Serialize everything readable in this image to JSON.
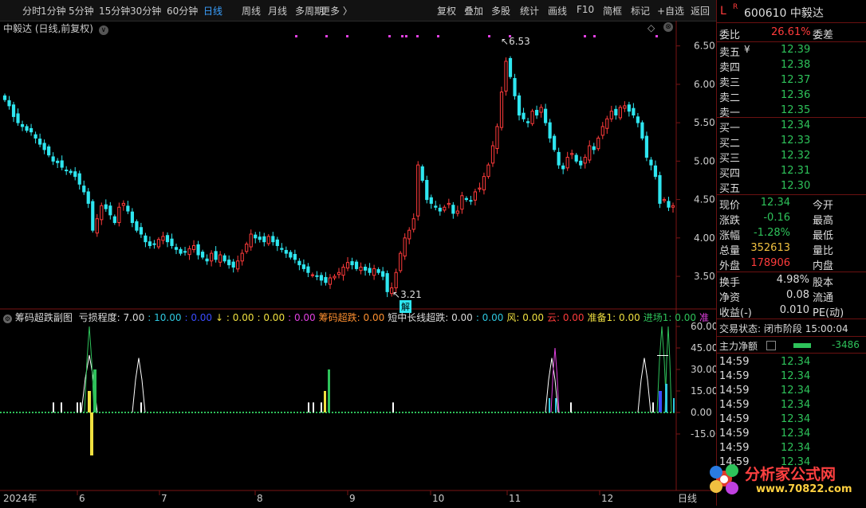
{
  "toolbar": {
    "left_tabs": [
      "分时",
      "1分钟",
      "5分钟",
      "15分钟",
      "30分钟",
      "60分钟",
      "日线",
      "周线",
      "月线",
      "多周期",
      "更多 〉"
    ],
    "active": "日线",
    "right_buttons": [
      "复权",
      "叠加",
      "多股",
      "统计",
      "画线",
      "F10",
      "简框",
      "标记",
      "+自选",
      "返回"
    ]
  },
  "main_title": "中毅达 (日线,前复权)",
  "y_ticks": [
    "6.50",
    "6.00",
    "5.50",
    "5.00",
    "4.50",
    "4.00",
    "3.50"
  ],
  "high_label": "6.53",
  "low_label": "3.21",
  "low_badge": "解",
  "indicator": {
    "name": "筹码超跌副图",
    "items": [
      {
        "label": "亏损程度: ",
        "value": "7.00",
        "color": "#ddd"
      },
      {
        "label": ": ",
        "value": "10.00",
        "color": "#2ec8e0"
      },
      {
        "label": ": ",
        "value": "0.00",
        "color": "#3a4cff"
      },
      {
        "label": "↓ : ",
        "value": "0.00",
        "color": "#f0e040"
      },
      {
        "label": ": ",
        "value": "0.00",
        "color": "#f0e040"
      },
      {
        "label": ": ",
        "value": "0.00",
        "color": "#e040e0"
      },
      {
        "label": "筹码超跌: ",
        "value": "0.00",
        "color": "#ff9030"
      },
      {
        "label": "短中长线超跌: ",
        "value": "0.00",
        "color": "#ddd"
      },
      {
        "label": ": ",
        "value": "0.00",
        "color": "#2ec8e0"
      },
      {
        "label": "风: ",
        "value": "0.00",
        "color": "#f0e040"
      },
      {
        "label": "云: ",
        "value": "0.00",
        "color": "#ff3b3b"
      },
      {
        "label": "准备1: ",
        "value": "0.00",
        "color": "#f0e040"
      },
      {
        "label": "进场1: ",
        "value": "0.00",
        "color": "#2ec25a"
      },
      {
        "label": "准",
        "value": "",
        "color": "#e040e0"
      }
    ],
    "y_ticks": [
      "60.00",
      "45.00",
      "30.00",
      "15.00",
      "0.00",
      "-15.00"
    ]
  },
  "x_labels": [
    "2024年",
    "6",
    "7",
    "8",
    "9",
    "10",
    "11",
    "12",
    "日线"
  ],
  "stock": {
    "code": "600610",
    "name": "中毅达",
    "l_badge": "L",
    "r_badge": "R"
  },
  "weibi": {
    "label": "委比",
    "value": "26.61%",
    "label2": "委差"
  },
  "asks": [
    {
      "label": "卖五",
      "mark": "¥",
      "price": "12.39"
    },
    {
      "label": "卖四",
      "mark": "",
      "price": "12.38"
    },
    {
      "label": "卖三",
      "mark": "",
      "price": "12.37"
    },
    {
      "label": "卖二",
      "mark": "",
      "price": "12.36"
    },
    {
      "label": "卖一",
      "mark": "",
      "price": "12.35"
    }
  ],
  "bids": [
    {
      "label": "买一",
      "price": "12.34"
    },
    {
      "label": "买二",
      "price": "12.33"
    },
    {
      "label": "买三",
      "price": "12.32"
    },
    {
      "label": "买四",
      "price": "12.31"
    },
    {
      "label": "买五",
      "price": "12.30"
    }
  ],
  "quote": [
    {
      "label": "现价",
      "value": "12.34",
      "color": "green",
      "label2": "今开"
    },
    {
      "label": "涨跌",
      "value": "-0.16",
      "color": "green",
      "label2": "最高"
    },
    {
      "label": "涨幅",
      "value": "-1.28%",
      "color": "green",
      "label2": "最低"
    },
    {
      "label": "总量",
      "value": "352613",
      "color": "yellow",
      "label2": "量比"
    },
    {
      "label": "外盘",
      "value": "178906",
      "color": "red",
      "label2": "内盘"
    }
  ],
  "stats": [
    {
      "label": "换手",
      "value": "4.98%",
      "label2": "股本"
    },
    {
      "label": "净资",
      "value": "0.08",
      "label2": "流通"
    },
    {
      "label": "收益(-)",
      "value": "0.010",
      "label2": "PE(动)"
    }
  ],
  "trade_status": {
    "label": "交易状态:",
    "value": "闭市阶段",
    "time": "15:00:04"
  },
  "net_flow": {
    "label": "主力净额",
    "value": "-3486"
  },
  "ticks": [
    {
      "time": "14:59",
      "price": "12.34"
    },
    {
      "time": "14:59",
      "price": "12.34"
    },
    {
      "time": "14:59",
      "price": "12.34"
    },
    {
      "time": "14:59",
      "price": "12.34"
    },
    {
      "time": "14:59",
      "price": "12.34"
    },
    {
      "time": "14:59",
      "price": "12.34"
    },
    {
      "time": "14:59",
      "price": "12.34"
    },
    {
      "time": "14:59",
      "price": "12.34"
    }
  ],
  "logo": {
    "text": "分析家公式网",
    "url": "www.70822.com"
  },
  "colors": {
    "up": "#ff3b3b",
    "down": "#2ee6f0",
    "accent": "#3aa0ff",
    "magenta": "#e040e0"
  },
  "chart_data": {
    "type": "candlestick",
    "ylim": [
      3.2,
      6.6
    ],
    "close": [
      5.8,
      5.72,
      5.58,
      5.5,
      5.45,
      5.4,
      5.38,
      5.3,
      5.22,
      5.15,
      5.08,
      5.0,
      4.98,
      4.92,
      4.88,
      4.85,
      4.8,
      4.7,
      4.6,
      4.45,
      4.1,
      4.25,
      4.42,
      4.38,
      4.3,
      4.2,
      4.4,
      4.45,
      4.35,
      4.2,
      4.1,
      4.05,
      3.95,
      3.9,
      3.92,
      3.98,
      4.02,
      3.95,
      3.9,
      3.85,
      3.8,
      3.82,
      3.86,
      3.9,
      3.78,
      3.75,
      3.7,
      3.8,
      3.72,
      3.78,
      3.7,
      3.65,
      3.62,
      3.7,
      3.8,
      3.92,
      4.05,
      4.0,
      3.98,
      3.95,
      4.02,
      3.95,
      3.9,
      3.85,
      3.8,
      3.75,
      3.72,
      3.65,
      3.6,
      3.55,
      3.52,
      3.5,
      3.45,
      3.42,
      3.48,
      3.5,
      3.55,
      3.62,
      3.68,
      3.65,
      3.6,
      3.62,
      3.58,
      3.55,
      3.6,
      3.55,
      3.5,
      3.3,
      3.35,
      3.55,
      3.8,
      4.0,
      4.1,
      4.25,
      4.95,
      4.75,
      4.5,
      4.45,
      4.4,
      4.35,
      4.4,
      4.45,
      4.32,
      4.35,
      4.55,
      4.5,
      4.48,
      4.6,
      4.65,
      4.8,
      4.95,
      5.2,
      5.45,
      5.9,
      6.3,
      6.1,
      5.85,
      5.6,
      5.55,
      5.5,
      5.65,
      5.6,
      5.7,
      5.5,
      5.3,
      5.15,
      4.95,
      4.9,
      5.05,
      5.1,
      5.0,
      4.95,
      5.05,
      5.2,
      5.15,
      5.3,
      5.45,
      5.55,
      5.65,
      5.6,
      5.7,
      5.72,
      5.65,
      5.6,
      5.5,
      5.3,
      5.05,
      4.95,
      4.8,
      4.45,
      4.5,
      4.4,
      4.42
    ]
  }
}
